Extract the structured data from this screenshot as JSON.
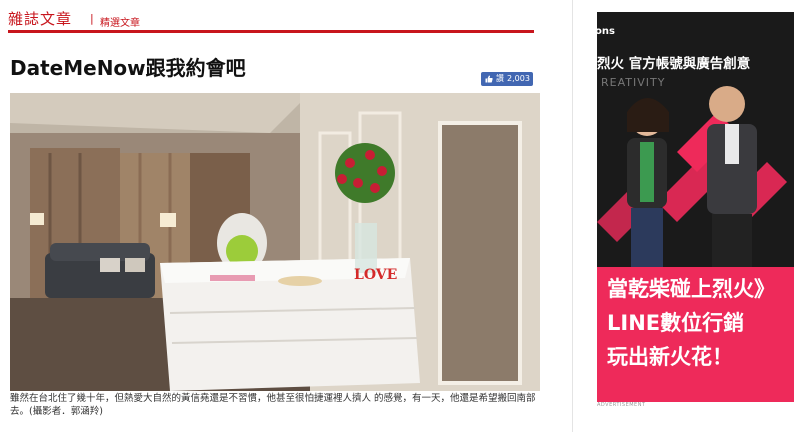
{
  "section": {
    "title": "雜誌文章",
    "separator": "|",
    "subtitle": "精選文章"
  },
  "article": {
    "title": "DateMeNow跟我約會吧",
    "like": {
      "label": "讚",
      "count": "2,003"
    },
    "caption": "雖然在台北住了幾十年，但熱愛大自然的黃信堯還是不習慣，他甚至很怕捷運裡人擠人 的感覺，有一天，他還是希望搬回南部去。(攝影者．郭涵羚)",
    "photo_sign": "LOVE"
  },
  "ad": {
    "brand": "ons",
    "headline": "烈火 官方帳號與廣告創意",
    "creativity": "REATIVITY",
    "lines": [
      "當乾柴碰上烈火》",
      "LINE數位行銷",
      "玩出新火花！"
    ],
    "label": "ADVERTISEMENT",
    "colors": {
      "accent": "#ee2a5a",
      "dark": "#1a1a1a"
    }
  },
  "colors": {
    "brand_red": "#c8161d",
    "facebook_blue": "#4267b2"
  }
}
